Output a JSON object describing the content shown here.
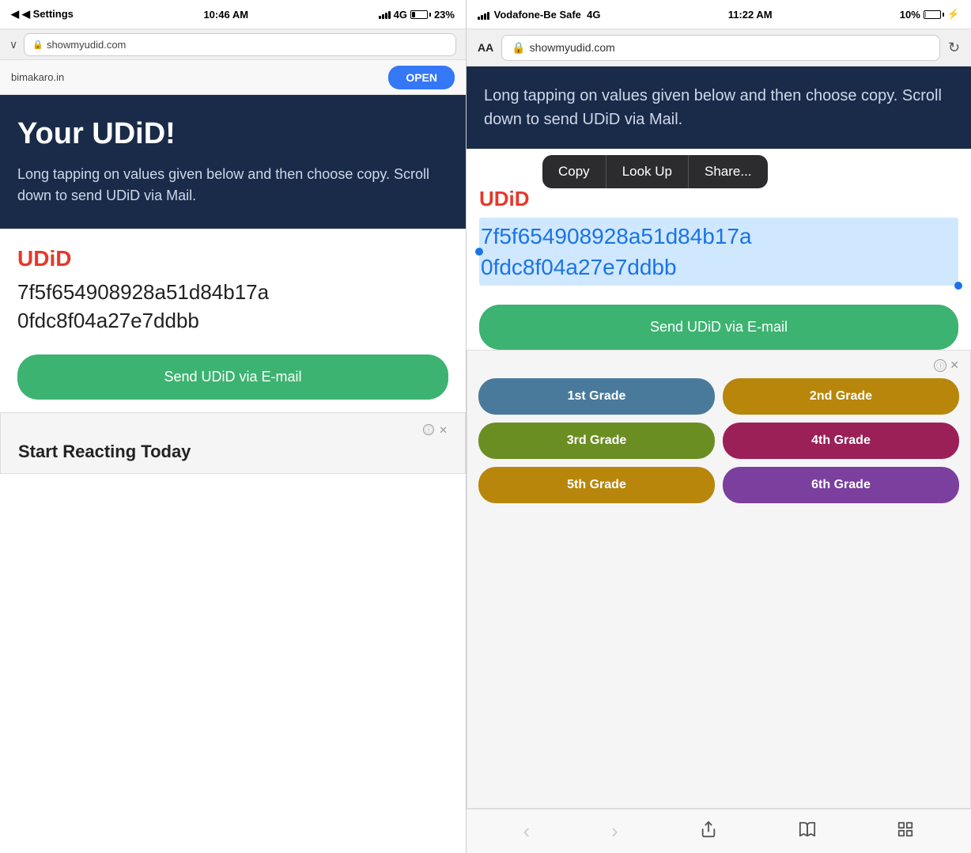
{
  "left": {
    "status_bar": {
      "left_label": "◀ Settings",
      "signal": "4G",
      "time": "10:46 AM",
      "battery_percent": "23%"
    },
    "url_bar": {
      "url": "showmyudid.com",
      "lock_icon": "🔒"
    },
    "ad_banner": {
      "domain": "bimakaro.in",
      "open_label": "OPEN"
    },
    "hero": {
      "title": "Your UDiD!",
      "description": "Long tapping on values given below and then choose copy. Scroll down to send UDiD via Mail."
    },
    "udid": {
      "label": "UDiD",
      "value_line1": "7f5f654908928a51d84b17a",
      "value_line2": "0fdc8f04a27e7ddbb"
    },
    "send_button": "Send UDiD via E-mail",
    "ad_bottom": {
      "ad_label": "Start Reacting Today"
    }
  },
  "right": {
    "status_bar": {
      "carrier": "Vodafone-Be Safe",
      "network": "4G",
      "time": "11:22 AM",
      "battery_percent": "10%"
    },
    "url_bar": {
      "aa_label": "AA",
      "url": "showmyudid.com",
      "lock_icon": "🔒"
    },
    "hero": {
      "description": "Long tapping on values given below and then choose copy. Scroll down to send UDiD via Mail."
    },
    "context_menu": {
      "items": [
        "Copy",
        "Look Up",
        "Share..."
      ]
    },
    "udid": {
      "label": "UDiD",
      "value_line1": "7f5f654908928a51d84b17a",
      "value_line2": "0fdc8f04a27e7ddbb"
    },
    "send_button": "Send UDiD via E-mail",
    "ad_bottom": {
      "grades": [
        "1st Grade",
        "2nd Grade",
        "3rd Grade",
        "4th Grade",
        "5th Grade",
        "6th Grade"
      ]
    },
    "toolbar": {
      "back_label": "‹",
      "forward_label": "›",
      "share_label": "⬆",
      "bookmarks_label": "📖",
      "tabs_label": "⧉"
    }
  }
}
